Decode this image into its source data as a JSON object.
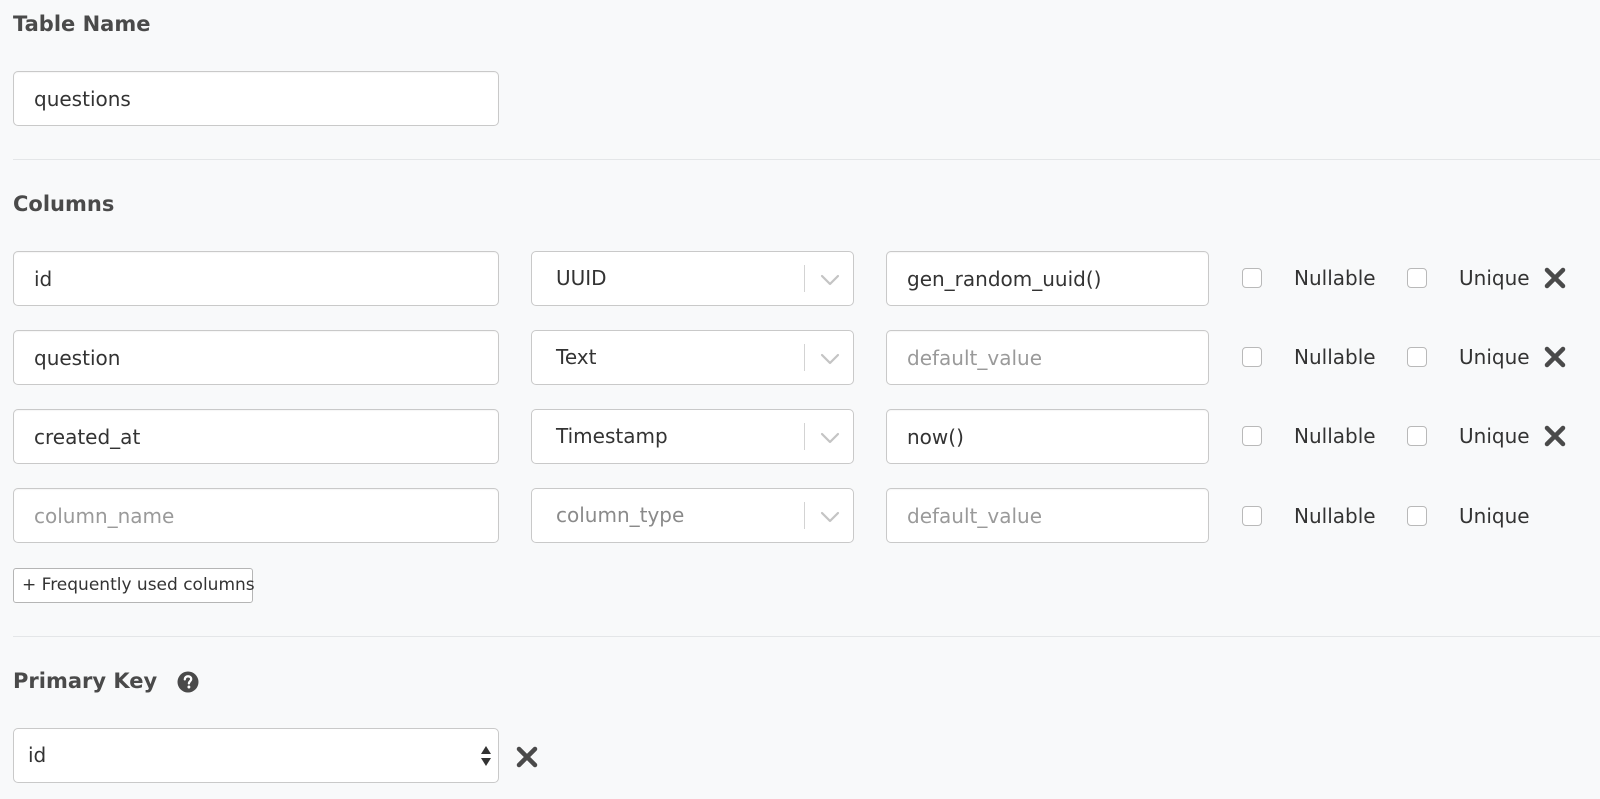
{
  "table_name": {
    "heading": "Table Name",
    "value": "questions"
  },
  "columns": {
    "heading": "Columns",
    "rows": [
      {
        "name": "id",
        "name_placeholder": "column_name",
        "type": "UUID",
        "default": "gen_random_uuid()",
        "default_placeholder": "default_value",
        "nullable_label": "Nullable",
        "unique_label": "Unique",
        "removable": true
      },
      {
        "name": "question",
        "name_placeholder": "column_name",
        "type": "Text",
        "default": "",
        "default_placeholder": "default_value",
        "nullable_label": "Nullable",
        "unique_label": "Unique",
        "removable": true
      },
      {
        "name": "created_at",
        "name_placeholder": "column_name",
        "type": "Timestamp",
        "default": "now()",
        "default_placeholder": "default_value",
        "nullable_label": "Nullable",
        "unique_label": "Unique",
        "removable": true
      },
      {
        "name": "",
        "name_placeholder": "column_name",
        "type": "column_type",
        "default": "",
        "default_placeholder": "default_value",
        "nullable_label": "Nullable",
        "unique_label": "Unique",
        "removable": false
      }
    ],
    "frequently_used_label": "+ Frequently used columns"
  },
  "primary_key": {
    "heading": "Primary Key",
    "help_icon": "question-circle-icon",
    "selected": "id"
  },
  "colors": {
    "background": "#f8f9fa",
    "heading": "#4a4a4a",
    "input_border": "#c9c9c9",
    "placeholder": "#9a9a9a",
    "icon": "#4a4a4a"
  }
}
